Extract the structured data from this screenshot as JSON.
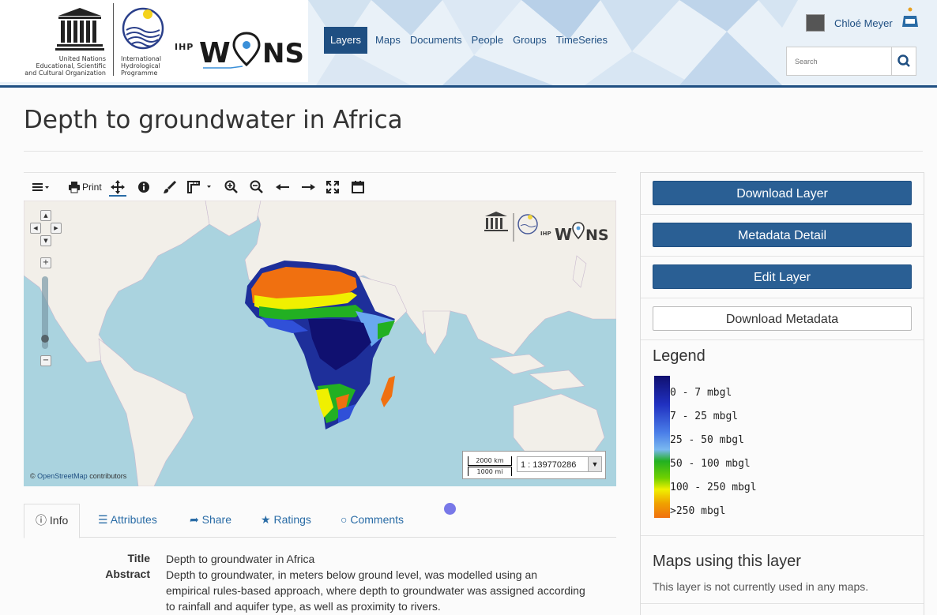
{
  "header": {
    "unesco_wordmark": "UNESCO",
    "unesco_org": "United Nations Educational, Scientific and Cultural Organization",
    "ihp_org": "International Hydrological Programme",
    "ihp_label": "IHP",
    "wins_label": "WINS",
    "nav": [
      {
        "label": "Layers",
        "active": true
      },
      {
        "label": "Maps"
      },
      {
        "label": "Documents"
      },
      {
        "label": "People"
      },
      {
        "label": "Groups"
      },
      {
        "label": "TimeSeries"
      }
    ],
    "user_name": "Chloé Meyer",
    "search_placeholder": "Search"
  },
  "page": {
    "title": "Depth to groundwater in Africa"
  },
  "map_toolbar": {
    "print_label": "Print",
    "icons": [
      "menu-icon",
      "print-icon",
      "pan-icon",
      "info-icon",
      "paint-brush-icon",
      "measure-icon",
      "zoom-in-icon",
      "zoom-out-icon",
      "back-icon",
      "forward-icon",
      "fullscreen-icon",
      "calendar-icon"
    ]
  },
  "map": {
    "scale_km": "2000 km",
    "scale_mi": "1000 mi",
    "scale_ratio": "1 : 139770286",
    "attribution_prefix": "©",
    "attribution_link": "OpenStreetMap",
    "attribution_suffix": "contributors",
    "ocean_color": "#aad3df",
    "land_color": "#f2efe9"
  },
  "tabs": [
    {
      "label": "Info",
      "icon": "info-icon",
      "active": true
    },
    {
      "label": "Attributes",
      "icon": "list-icon"
    },
    {
      "label": "Share",
      "icon": "share-icon"
    },
    {
      "label": "Ratings",
      "icon": "star-icon"
    },
    {
      "label": "Comments",
      "icon": "comment-icon"
    }
  ],
  "info": {
    "title_label": "Title",
    "title_value": "Depth to groundwater in Africa",
    "abstract_label": "Abstract",
    "abstract_lines": [
      "Depth to groundwater, in meters below ground level, was modelled using an",
      "empirical rules-based approach, where depth to groundwater was assigned according",
      "to rainfall and aquifer type, as well as proximity to rivers."
    ]
  },
  "sidebar": {
    "download_layer": "Download Layer",
    "metadata_detail": "Metadata Detail",
    "edit_layer": "Edit Layer",
    "download_metadata": "Download Metadata",
    "legend_title": "Legend",
    "legend": [
      {
        "label": "0 - 7 mbgl",
        "color": "#101070"
      },
      {
        "label": "7 - 25 mbgl",
        "color": "#3050d8"
      },
      {
        "label": "25 - 50 mbgl",
        "color": "#6aa8f0"
      },
      {
        "label": "50 - 100 mbgl",
        "color": "#22b022"
      },
      {
        "label": "100 - 250 mbgl",
        "color": "#f0f000"
      },
      {
        "label": ">250 mbgl",
        "color": "#f07010"
      }
    ],
    "maps_title": "Maps using this layer",
    "maps_text": "This layer is not currently used in any maps."
  },
  "colors": {
    "brand": "#1f4f82",
    "button": "#2a5f94"
  }
}
